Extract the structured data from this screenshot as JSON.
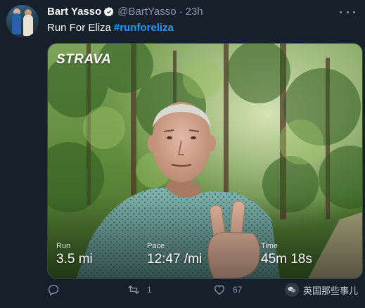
{
  "tweet": {
    "author_name": "Bart Yasso",
    "author_handle": "@BartYasso",
    "separator": "·",
    "time": "23h",
    "text": "Run For Eliza",
    "hashtag": "#runforeliza",
    "colors": {
      "background": "#15202b",
      "accent": "#1d9bf0",
      "muted": "#8b98a5"
    }
  },
  "media": {
    "brand": "STRAVA",
    "stats": [
      {
        "label": "Run",
        "value": "3.5 mi"
      },
      {
        "label": "Pace",
        "value": "12:47 /mi"
      },
      {
        "label": "Time",
        "value": "45m 18s"
      }
    ]
  },
  "actions": {
    "reply": {
      "icon": "reply-icon",
      "count": ""
    },
    "retweet": {
      "icon": "retweet-icon",
      "count": "1"
    },
    "like": {
      "icon": "heart-icon",
      "count": "67"
    },
    "share": {
      "icon": "share-icon",
      "count": ""
    }
  },
  "watermark": {
    "text": "英国那些事儿"
  }
}
